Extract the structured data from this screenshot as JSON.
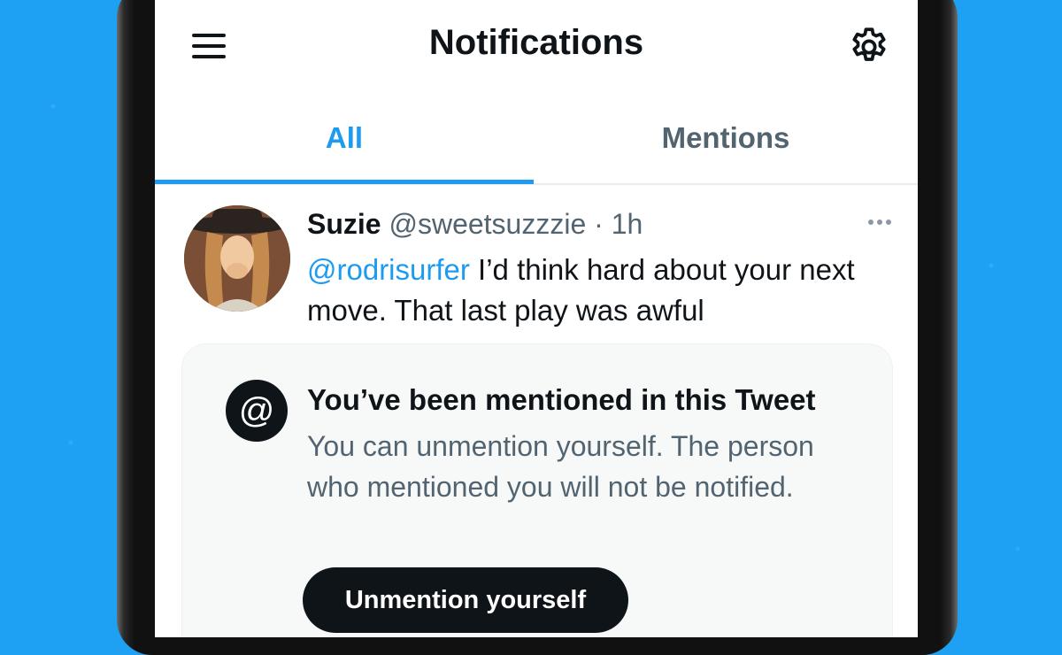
{
  "header": {
    "title": "Notifications",
    "menu_icon": "hamburger-menu-icon",
    "settings_icon": "gear-icon"
  },
  "tabs": [
    {
      "label": "All",
      "active": true
    },
    {
      "label": "Mentions",
      "active": false
    }
  ],
  "tweet": {
    "display_name": "Suzie",
    "handle": "@sweetsuzzzie",
    "separator": "·",
    "time": "1h",
    "mention": "@rodrisurfer",
    "text": " I’d think hard about your next move. That last play was awful",
    "more_icon": "more-dots-icon"
  },
  "mention_card": {
    "icon": "at-sign-icon",
    "at_glyph": "@",
    "title": "You’ve been mentioned in this Tweet",
    "description": "You can unmention yourself. The person who mentioned you will not be notified.",
    "button_label": "Unmention yourself"
  },
  "colors": {
    "accent": "#1d9bf0",
    "background": "#1ea1f2",
    "text_primary": "#0f1419",
    "text_secondary": "#536471"
  }
}
